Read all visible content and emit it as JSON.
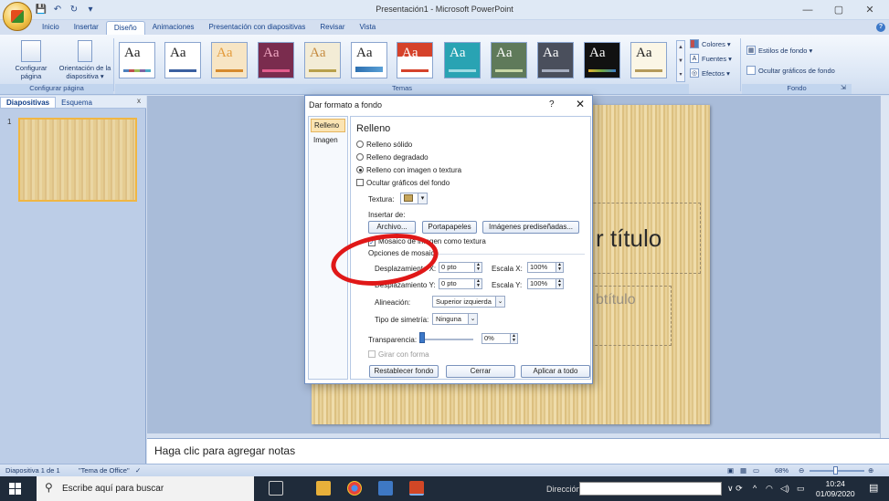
{
  "window": {
    "title": "Presentación1 - Microsoft PowerPoint",
    "minimize": "—",
    "maximize": "▢",
    "close": "✕"
  },
  "qat": {
    "save": "💾",
    "undo": "↶",
    "redo": "↻",
    "more": "▾"
  },
  "tabs": [
    "Inicio",
    "Insertar",
    "Diseño",
    "Animaciones",
    "Presentación con diapositivas",
    "Revisar",
    "Vista"
  ],
  "active_tab": "Diseño",
  "ribbon": {
    "page_setup_group": "Configurar página",
    "page_setup_btn": "Configurar página",
    "orientation_btn": "Orientación de la diapositiva ▾",
    "themes_group": "Temas",
    "theme_sample": "Aa",
    "colors": "Colores ▾",
    "fonts": "Fuentes ▾",
    "effects": "Efectos ▾",
    "bg_styles": "Estilos de fondo ▾",
    "hide_bg": "Ocultar gráficos de fondo",
    "background_group": "Fondo"
  },
  "left_pane": {
    "tab_slides": "Diapositivas",
    "tab_outline": "Esquema",
    "close": "x",
    "slide_number": "1"
  },
  "slide": {
    "title_placeholder": "r título",
    "subtitle_placeholder": "btítulo"
  },
  "notes": {
    "placeholder": "Haga clic para agregar notas"
  },
  "status": {
    "slide": "Diapositiva 1 de 1",
    "theme": "\"Tema de Office\"",
    "zoom": "68%"
  },
  "dialog": {
    "title": "Dar formato a fondo",
    "help": "?",
    "close": "✕",
    "nav": [
      "Relleno",
      "Imagen"
    ],
    "heading": "Relleno",
    "solid": "Relleno sólido",
    "gradient": "Relleno degradado",
    "picture": "Relleno con imagen o textura",
    "hide_graphics": "Ocultar gráficos del fondo",
    "texture_label": "Textura:",
    "insert_from": "Insertar de:",
    "btn_file": "Archivo...",
    "btn_clipboard": "Portapapeles",
    "btn_clipart": "Imágenes prediseñadas...",
    "tile": "Mosaico de imagen como textura",
    "tile_options": "Opciones de mosaico",
    "offset_x_label": "Desplazamiento X:",
    "offset_x": "0 pto",
    "offset_y_label": "Desplazamiento Y:",
    "offset_y": "0 pto",
    "scale_x_label": "Escala X:",
    "scale_x": "100%",
    "scale_y_label": "Escala Y:",
    "scale_y": "100%",
    "alignment_label": "Alineación:",
    "alignment": "Superior izquierda",
    "mirror_label": "Tipo de simetría:",
    "mirror": "Ninguna",
    "transparency_label": "Transparencia:",
    "transparency": "0%",
    "transparency_level": 0,
    "rotate_with_shape": "Girar con forma",
    "btn_reset": "Restablecer fondo",
    "btn_close": "Cerrar",
    "btn_apply_all": "Aplicar a todo"
  },
  "taskbar": {
    "search": "Escribe aquí para buscar",
    "address_label": "Dirección",
    "time": "10:24",
    "date": "01/09/2020"
  }
}
